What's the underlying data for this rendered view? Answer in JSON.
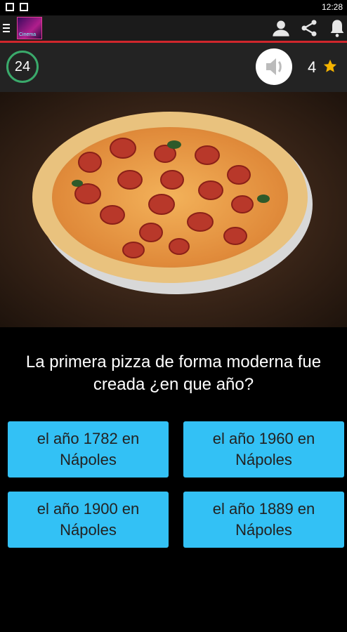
{
  "status_bar": {
    "time": "12:28"
  },
  "header": {
    "logo_caption": "Cinema"
  },
  "score_bar": {
    "timer": "24",
    "score": "4"
  },
  "question": {
    "text": "La primera pizza de forma moderna fue creada ¿en que año?"
  },
  "answers": [
    {
      "text": "el año 1782 en Nápoles"
    },
    {
      "text": "el año 1960 en Nápoles"
    },
    {
      "text": "el año 1900 en Nápoles"
    },
    {
      "text": "el año 1889 en Nápoles"
    }
  ],
  "colors": {
    "accent_red": "#d0262c",
    "answer_bg": "#33c1f5",
    "timer_ring": "#3aaa6b",
    "star": "#f5b400"
  }
}
